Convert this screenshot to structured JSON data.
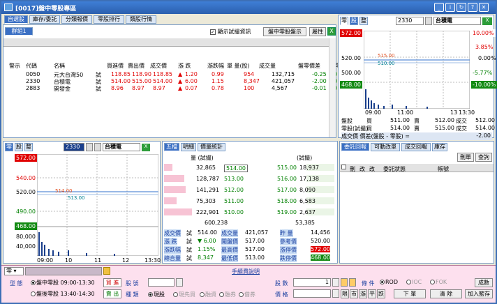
{
  "window": {
    "title": "[0017]盤中零股專區"
  },
  "top_tabs": [
    "自選股",
    "庫存/委託",
    "分類報價",
    "零股排行",
    "類股行情"
  ],
  "watchlist": {
    "group_tab": "群組1",
    "show_trial_label": "顯示試撮資訊",
    "btn_odd_lot": "盤中零股盤示",
    "btn_props": "屬性",
    "headers": [
      "警示",
      "代碼",
      "名稱",
      "",
      "買進價",
      "賣出價",
      "成交價",
      "漲 跌",
      "漲跌幅",
      "單 量(股)",
      "成交量",
      "盤零價差",
      "盤零價"
    ],
    "rows": [
      {
        "code": "0050",
        "name": "元大台灣50",
        "flag": "試",
        "bid": "118.85",
        "ask": "118.90",
        "last": "118.85",
        "chg": "1.20",
        "pct": "0.99",
        "qty": "954",
        "vol": "132,715",
        "diff": "-0.25",
        "diff2": "-0",
        "dir": "up"
      },
      {
        "code": "2330",
        "name": "台積電",
        "flag": "試",
        "bid": "514.00",
        "ask": "515.00",
        "last": "514.00",
        "chg": "6.00",
        "pct": "1.15",
        "qty": "8,347",
        "vol": "421,057",
        "diff": "-2.00",
        "diff2": "-0",
        "dir": "up"
      },
      {
        "code": "2883",
        "name": "開發金",
        "flag": "試",
        "bid": "8.96",
        "ask": "8.97",
        "last": "8.97",
        "chg": "0.07",
        "pct": "0.78",
        "qty": "100",
        "vol": "4,567",
        "diff": "-0.01",
        "diff2": "-0",
        "dir": "up"
      }
    ]
  },
  "right_chart": {
    "tabs": [
      "零",
      "股",
      "整"
    ],
    "code": "2330",
    "name": "台積電",
    "top_price": "572.00",
    "top_pct": "10.00%",
    "pct_385": "3.85%",
    "p520": "520.00",
    "p500": "500.00",
    "pct_000": "0.00%",
    "pct_577": "-5.77%",
    "low_price": "468.00",
    "low_pct": "-10.00%",
    "label_515": "515.00",
    "label_510": "510.00",
    "times": [
      "09:00",
      "11:00",
      "13",
      "13:30"
    ],
    "quote_rows": [
      {
        "label": "盤股",
        "b": "買",
        "bv": "511.00",
        "s": "賣",
        "sv": "512.00",
        "t": "成交",
        "tv": "512.00"
      },
      {
        "label": "零股(試撮)",
        "b": "買",
        "bv": "514.00",
        "s": "賣",
        "sv": "515.00",
        "t": "成交",
        "tv": "514.00"
      }
    ],
    "spread_label": "成交價 價差(盤股 - 零股) =",
    "spread_value": "-2.00"
  },
  "left_chart": {
    "tabs": [
      "零",
      "股",
      "整"
    ],
    "code": "2330",
    "name": "台積電",
    "top_price": "572.00",
    "p540": "540.00",
    "p520": "520.00",
    "p490": "490.00",
    "low_price": "468.00",
    "v80": "80,000",
    "v40": "40,000",
    "label_514": "514.00",
    "label_513": "513.00",
    "times": [
      "09:00",
      "10",
      "11",
      "12",
      "13:30"
    ]
  },
  "depth": {
    "tabs": [
      "五檔",
      "明細",
      "價量統計"
    ],
    "head_left": "量   (試撮)",
    "head_right": "(試撮)",
    "rows": [
      {
        "bq": "32,865",
        "bp": "514.00",
        "ap": "515.00",
        "aq": "18,937",
        "w": 40
      },
      {
        "bq": "128,787",
        "bp": "513.00",
        "ap": "516.00",
        "aq": "17,138",
        "w": 95
      },
      {
        "bq": "141,291",
        "bp": "512.00",
        "ap": "517.00",
        "aq": "8,090",
        "w": 100
      },
      {
        "bq": "75,303",
        "bp": "511.00",
        "ap": "518.00",
        "aq": "6,583",
        "w": 60
      },
      {
        "bq": "222,901",
        "bp": "510.00",
        "ap": "519.00",
        "aq": "2,637",
        "w": 130
      }
    ],
    "total_bid": "600,238",
    "total_ask": "53,385",
    "stats": [
      {
        "l1": "成交價",
        "f1": "試",
        "v1": "514.00",
        "l2": "成交量",
        "v2": "421,057",
        "l3": "昨  量",
        "v3": "14,456"
      },
      {
        "l1": "漲  跌",
        "f1": "試",
        "v1": "▼ 6.00",
        "l2": "開盤價",
        "v2": "517.00",
        "l3": "參考價",
        "v3": "520.00"
      },
      {
        "l1": "漲跌幅",
        "f1": "試",
        "v1": "1.15%",
        "l2": "最高價",
        "v2": "517.00",
        "l3": "漲停價",
        "v3": "572.00"
      },
      {
        "l1": "總合量",
        "f1": "試",
        "v1": "8,347",
        "l2": "最低價",
        "v2": "513.00",
        "l3": "跌停價",
        "v3": "468.00"
      }
    ]
  },
  "orders": {
    "tabs": [
      "委託回報",
      "可動改單",
      "成交回報",
      "庫存"
    ],
    "btn_delete": "刪單",
    "btn_query": "查詢",
    "headers": [
      "刪",
      "改",
      "改",
      "委託狀態",
      "帳號"
    ]
  },
  "order_bar": {
    "instructions": "手續費說明",
    "type_label": "型  態",
    "opt_intraday": "盤中零股",
    "opt_intraday_time": "09:00-13:30",
    "opt_after": "盤後零股",
    "opt_after_time": "13:40-14:30",
    "buy": "買 進",
    "sell": "賣 出",
    "stock_label": "股  號",
    "kind_label": "種  類",
    "kinds": [
      "現股",
      "現先買",
      "融資",
      "融券",
      "借券"
    ],
    "shares_label": "股  數",
    "shares_value": "1",
    "price_label": "價  格",
    "price_btns": [
      "限",
      "市",
      "漲",
      "平",
      "跌"
    ],
    "cond_label": "條  件",
    "conds": [
      "ROD",
      "IOC",
      "FOK"
    ],
    "place_order": "下 單",
    "clear": "清 除",
    "add_basket": "加入籃存",
    "deal": "成數"
  }
}
